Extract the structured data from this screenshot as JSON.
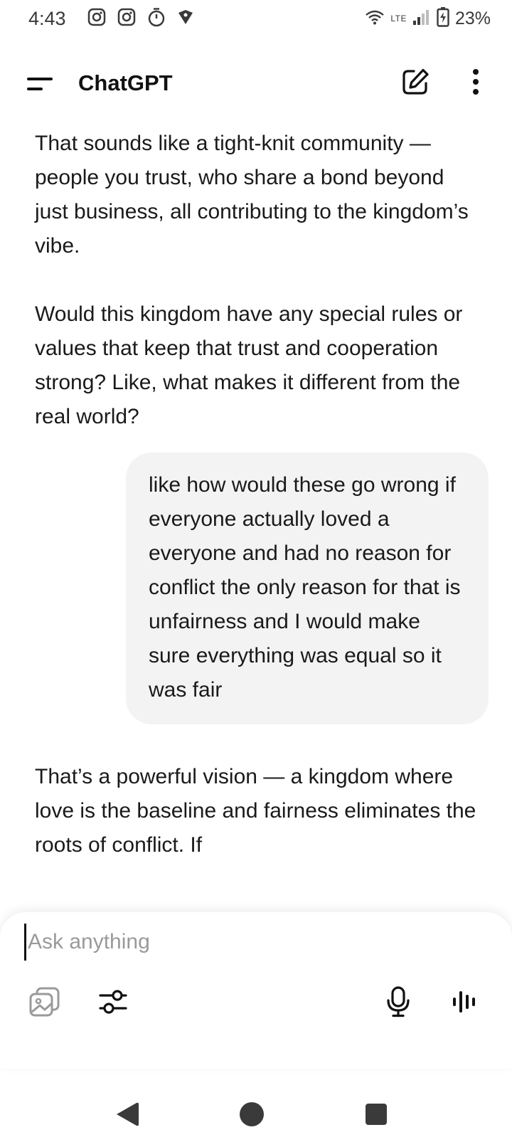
{
  "status_bar": {
    "time": "4:43",
    "network": "LTE",
    "battery": "23%",
    "icons": [
      "instagram-icon",
      "instagram-icon",
      "stopwatch-icon",
      "shield-icon",
      "wifi-icon",
      "signal-icon",
      "battery-charging-icon"
    ]
  },
  "header": {
    "title": "ChatGPT",
    "icons": [
      "menu-icon",
      "new-chat-icon",
      "more-vert-icon"
    ]
  },
  "messages": {
    "assistant_1": {
      "para_1": "That sounds like a tight-knit community — people you trust, who share a bond beyond just business, all contributing to the kingdom’s vibe.",
      "para_2": "Would this kingdom have any special rules or values that keep that trust and cooperation strong? Like, what makes it different from the real world?"
    },
    "user_1": "like how would these go wrong if everyone actually loved a everyone and had no reason for conflict the only reason for that is unfairness and I would make sure everything was equal so it was fair",
    "assistant_2": "That’s a powerful vision — a kingdom where love is the baseline and fairness eliminates the roots of conflict. If"
  },
  "composer": {
    "placeholder": "Ask anything",
    "value": "",
    "icons": [
      "image-icon",
      "sliders-icon",
      "microphone-icon",
      "voice-waveform-icon"
    ]
  },
  "nav_bar": {
    "icons": [
      "back-icon",
      "home-icon",
      "recents-icon"
    ]
  },
  "colors": {
    "user_bubble": "#f3f3f3",
    "text": "#1a1a1a",
    "placeholder": "#9a9a9a"
  }
}
